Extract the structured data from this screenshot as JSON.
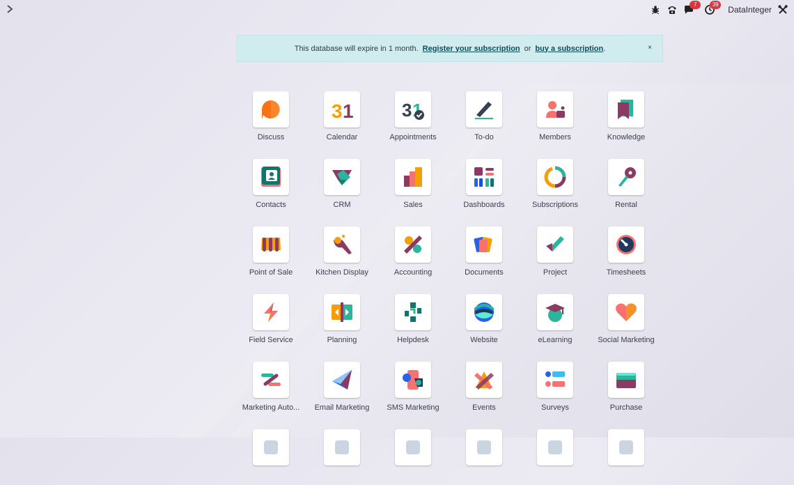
{
  "topbar": {
    "menu_toggle_icon": "chevron-right-icon",
    "company_name": "DataInteger",
    "messages_badge": "7",
    "activities_badge": "39",
    "icons": [
      "bug-icon",
      "phone-icon",
      "chat-icon",
      "clock-icon",
      "tools-icon"
    ]
  },
  "banner": {
    "text_before": "This database will expire in 1 month.",
    "register_link": "Register your subscription",
    "or_text": "or",
    "buy_link": "buy a subscription",
    "end_text": ".",
    "close_label": "×",
    "bg_color": "#d1ecef"
  },
  "apps": [
    {
      "label": "Discuss",
      "icon": "discuss-icon"
    },
    {
      "label": "Calendar",
      "icon": "calendar-icon"
    },
    {
      "label": "Appointments",
      "icon": "appointments-icon"
    },
    {
      "label": "To-do",
      "icon": "todo-icon"
    },
    {
      "label": "Members",
      "icon": "members-icon"
    },
    {
      "label": "Knowledge",
      "icon": "knowledge-icon"
    },
    {
      "label": "Contacts",
      "icon": "contacts-icon"
    },
    {
      "label": "CRM",
      "icon": "crm-icon"
    },
    {
      "label": "Sales",
      "icon": "sales-icon"
    },
    {
      "label": "Dashboards",
      "icon": "dashboards-icon"
    },
    {
      "label": "Subscriptions",
      "icon": "subscriptions-icon"
    },
    {
      "label": "Rental",
      "icon": "rental-icon"
    },
    {
      "label": "Point of Sale",
      "icon": "point-of-sale-icon"
    },
    {
      "label": "Kitchen Display",
      "icon": "kitchen-display-icon"
    },
    {
      "label": "Accounting",
      "icon": "accounting-icon"
    },
    {
      "label": "Documents",
      "icon": "documents-icon"
    },
    {
      "label": "Project",
      "icon": "project-icon"
    },
    {
      "label": "Timesheets",
      "icon": "timesheets-icon"
    },
    {
      "label": "Field Service",
      "icon": "field-service-icon"
    },
    {
      "label": "Planning",
      "icon": "planning-icon"
    },
    {
      "label": "Helpdesk",
      "icon": "helpdesk-icon"
    },
    {
      "label": "Website",
      "icon": "website-icon"
    },
    {
      "label": "eLearning",
      "icon": "elearning-icon"
    },
    {
      "label": "Social Marketing",
      "icon": "social-marketing-icon"
    },
    {
      "label": "Marketing Auto...",
      "icon": "marketing-automation-icon"
    },
    {
      "label": "Email Marketing",
      "icon": "email-marketing-icon"
    },
    {
      "label": "SMS Marketing",
      "icon": "sms-marketing-icon"
    },
    {
      "label": "Events",
      "icon": "events-icon"
    },
    {
      "label": "Surveys",
      "icon": "surveys-icon"
    },
    {
      "label": "Purchase",
      "icon": "purchase-icon"
    },
    {
      "label": "",
      "icon": "app-icon"
    },
    {
      "label": "",
      "icon": "app-icon"
    },
    {
      "label": "",
      "icon": "app-icon"
    },
    {
      "label": "",
      "icon": "app-icon"
    },
    {
      "label": "",
      "icon": "app-icon"
    },
    {
      "label": "",
      "icon": "app-icon"
    }
  ]
}
